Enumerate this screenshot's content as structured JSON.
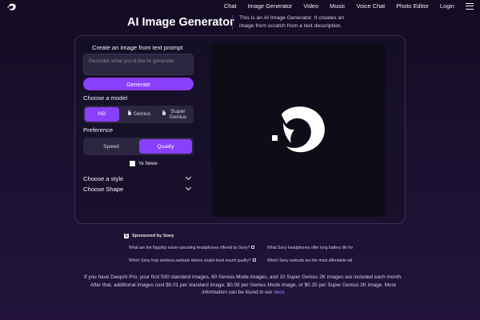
{
  "nav": {
    "logo_icon": "deepai-logo-icon",
    "links": [
      "Chat",
      "Image Generator",
      "Video",
      "Music",
      "Voice Chat",
      "Photo Editor",
      "Login"
    ],
    "menu_icon": "hamburger-menu-icon"
  },
  "header": {
    "title": "AI Image Generator",
    "subtitle": "This is an AI Image Generator. It creates an image from scratch from a text description."
  },
  "form": {
    "prompt_heading": "Create an image from text prompt",
    "prompt_placeholder": "Describe what you'd like to generate",
    "prompt_value": "",
    "generate_label": "Generate",
    "model_heading": "Choose a model",
    "models": [
      {
        "label": "HD",
        "active": true,
        "locked": false
      },
      {
        "label": "Genius",
        "active": false,
        "locked": true
      },
      {
        "label": "Super Genius",
        "active": false,
        "locked": true
      }
    ],
    "preference_heading": "Preference",
    "preferences": [
      {
        "label": "Speed",
        "active": false
      },
      {
        "label": "Quality",
        "active": true
      }
    ],
    "checkbox_label": "Ye Newe",
    "style_label": "Choose a style",
    "shape_label": "Choose Shape"
  },
  "sponsored": {
    "heading": "Sponsored by Sony",
    "ads": [
      "What are the flagship noise-canceling headphones offered by Sony?",
      "What Sony headphones offer long battery life for",
      "Which Sony truly wireless earbuds deliver studio-level sound quality?",
      "Which Sony earbuds are the most affordable wit"
    ]
  },
  "footer": {
    "text": "If you have DeepAI Pro, your first 500 standard images, 60 Genius Mode images, and 10 Super Genius 2K images are included each month. After that, additional images cost $0.01 per standard image, $0.08 per Genius Mode image, or $0.25 per Super Genius 2K image. More information can be found in our",
    "link": "docs"
  },
  "colors": {
    "accent": "#8a3ffc",
    "background": "#1b1030",
    "panel": "#2c2640"
  }
}
